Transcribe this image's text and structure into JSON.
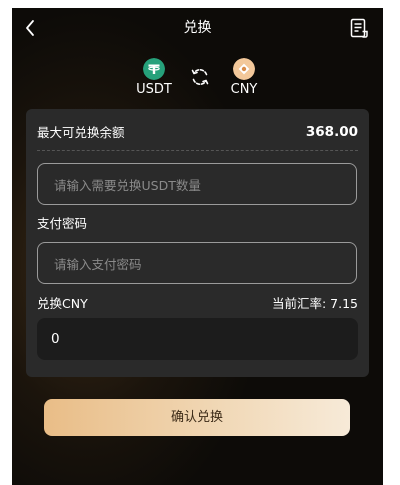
{
  "header": {
    "title": "兑换",
    "back_icon": "chevron-left-icon",
    "record_icon": "document-list-icon"
  },
  "pair": {
    "from": {
      "label": "USDT",
      "icon": "tether-icon",
      "color": "#26a17b"
    },
    "to": {
      "label": "CNY",
      "icon": "cny-icon",
      "color": "#f3c89a"
    },
    "swap_icon": "refresh-swap-icon"
  },
  "form": {
    "balance_label": "最大可兑换余额",
    "balance_value": "368.00",
    "amount_placeholder": "请输入需要兑换USDT数量",
    "amount_value": "",
    "password_label": "支付密码",
    "password_placeholder": "请输入支付密码",
    "password_value": "",
    "cny_label": "兑换CNY",
    "rate_text": "当前汇率:  7.15",
    "result_value": "0"
  },
  "actions": {
    "confirm_label": "确认兑换"
  },
  "colors": {
    "card_bg": "#2a2a2a",
    "accent_gold": "#e9bd87"
  }
}
